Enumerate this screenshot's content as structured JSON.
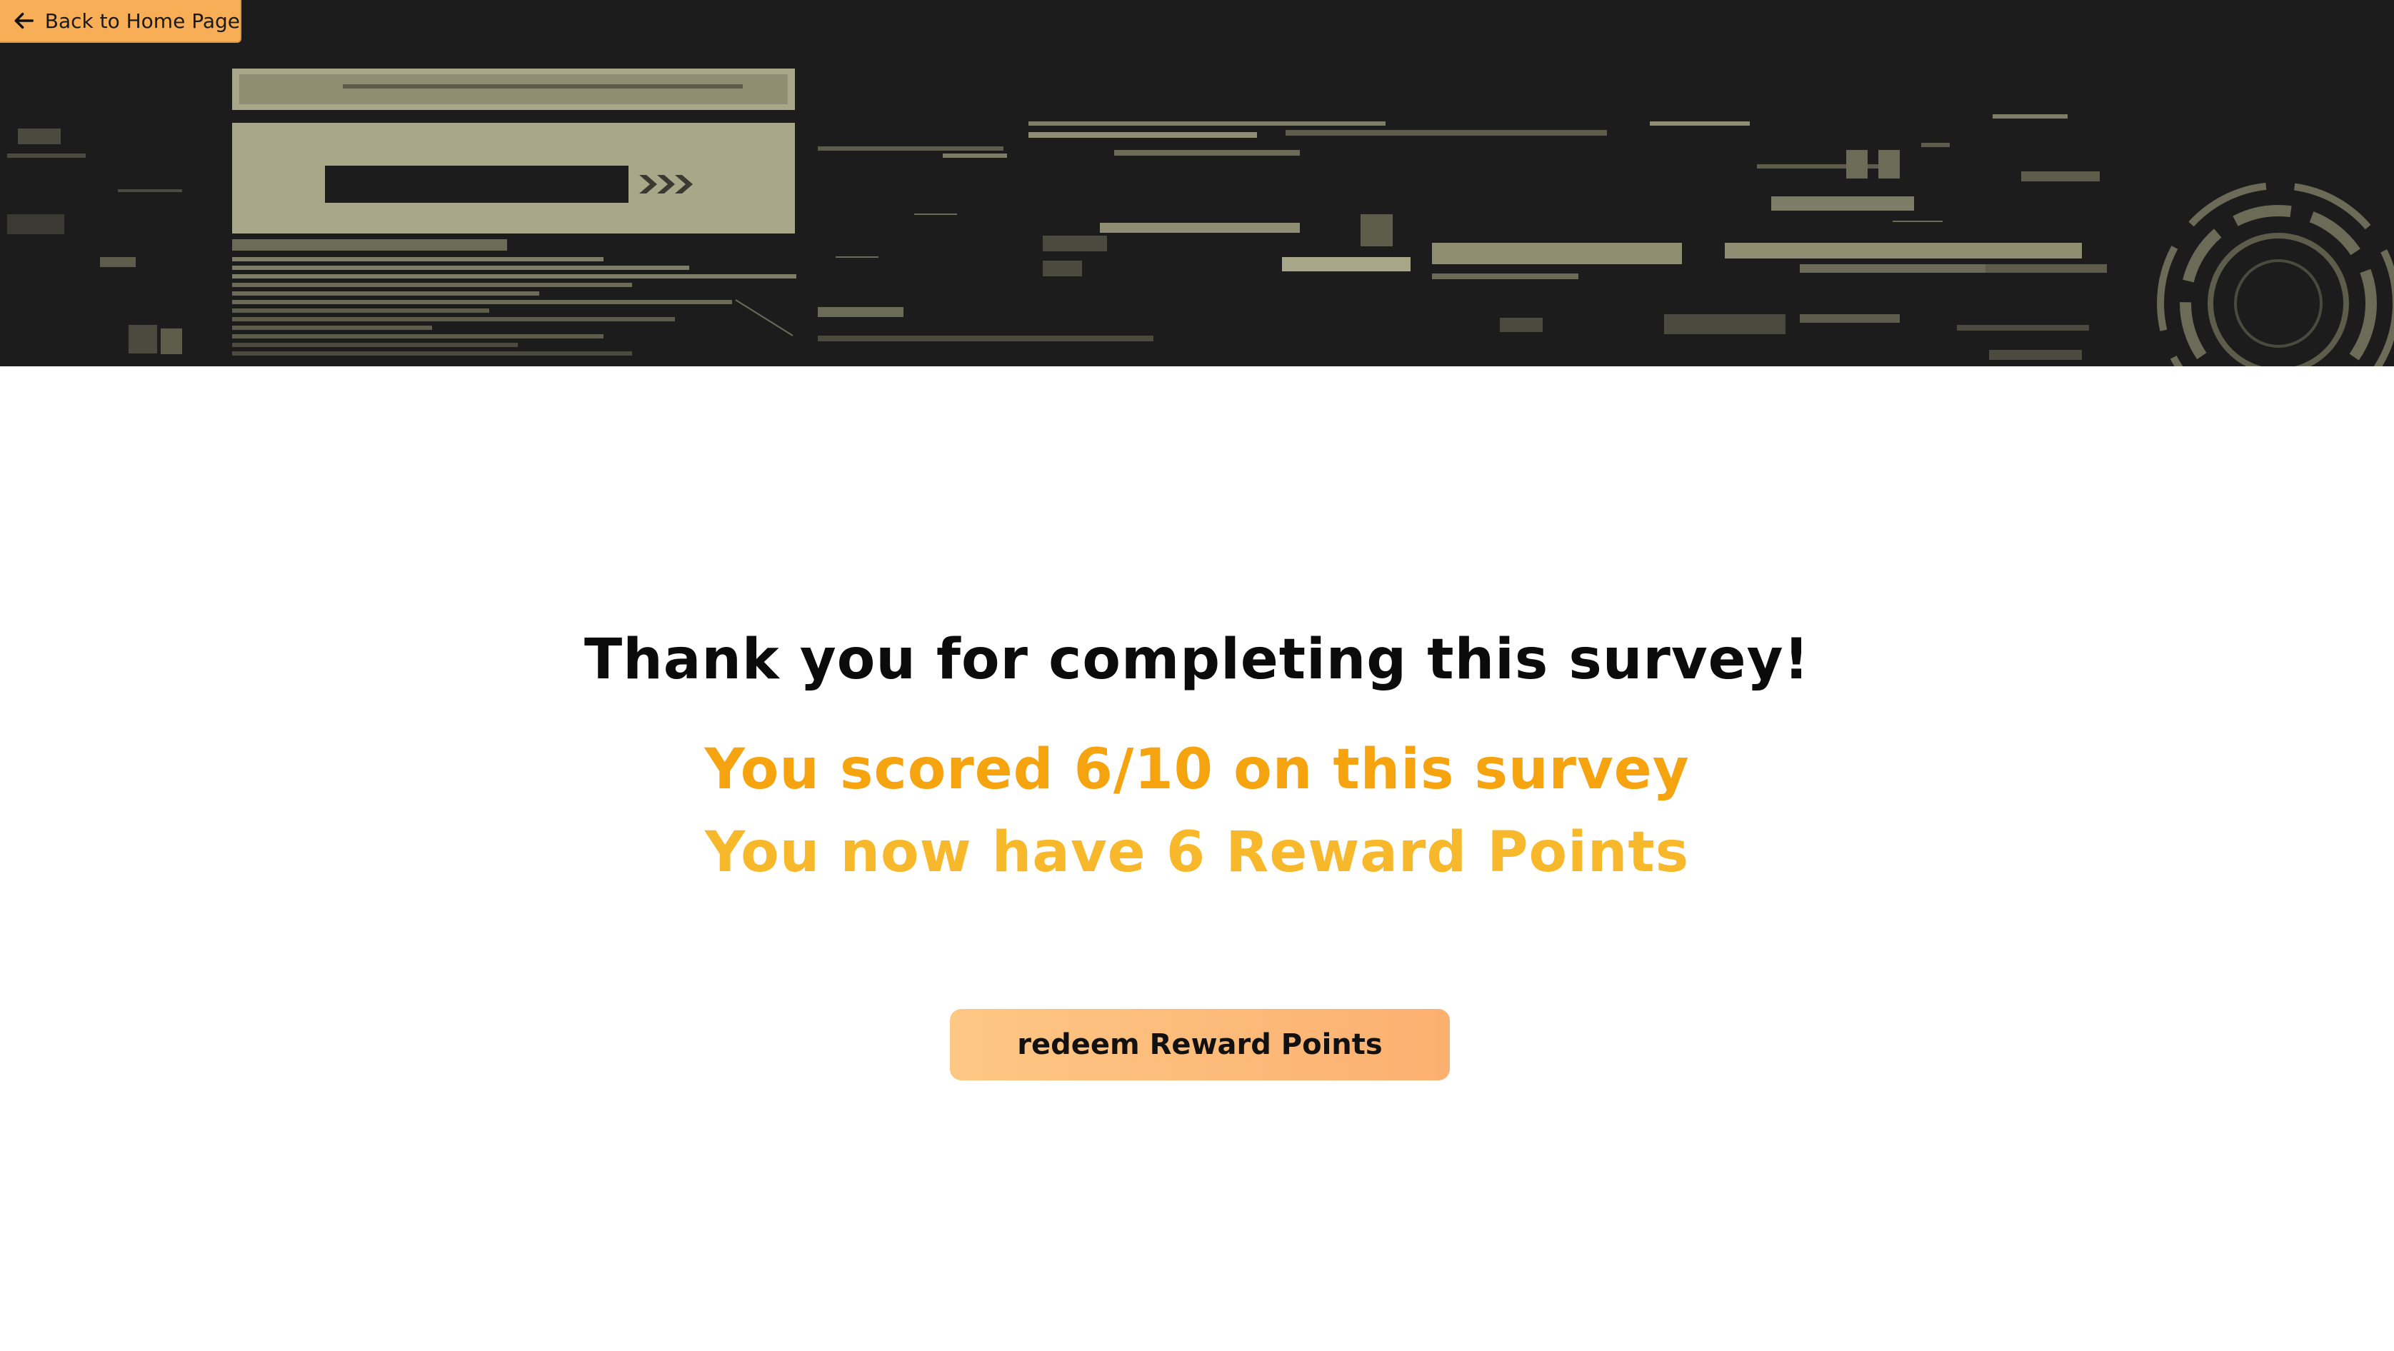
{
  "header": {
    "back_button_label": "Back to Home Page",
    "back_icon": "arrow-left-icon"
  },
  "main": {
    "title": "Thank you for completing this survey!",
    "score_text": "You scored 6/10 on this survey",
    "points_text": "You now have 6 Reward Points",
    "redeem_button_label": "redeem Reward Points"
  },
  "colors": {
    "accent_orange": "#f5a30f",
    "accent_yellow": "#f7b92b",
    "button_orange": "#f7ae56",
    "banner_bg": "#1c1c1c",
    "banner_detail": "#a8a78a"
  }
}
